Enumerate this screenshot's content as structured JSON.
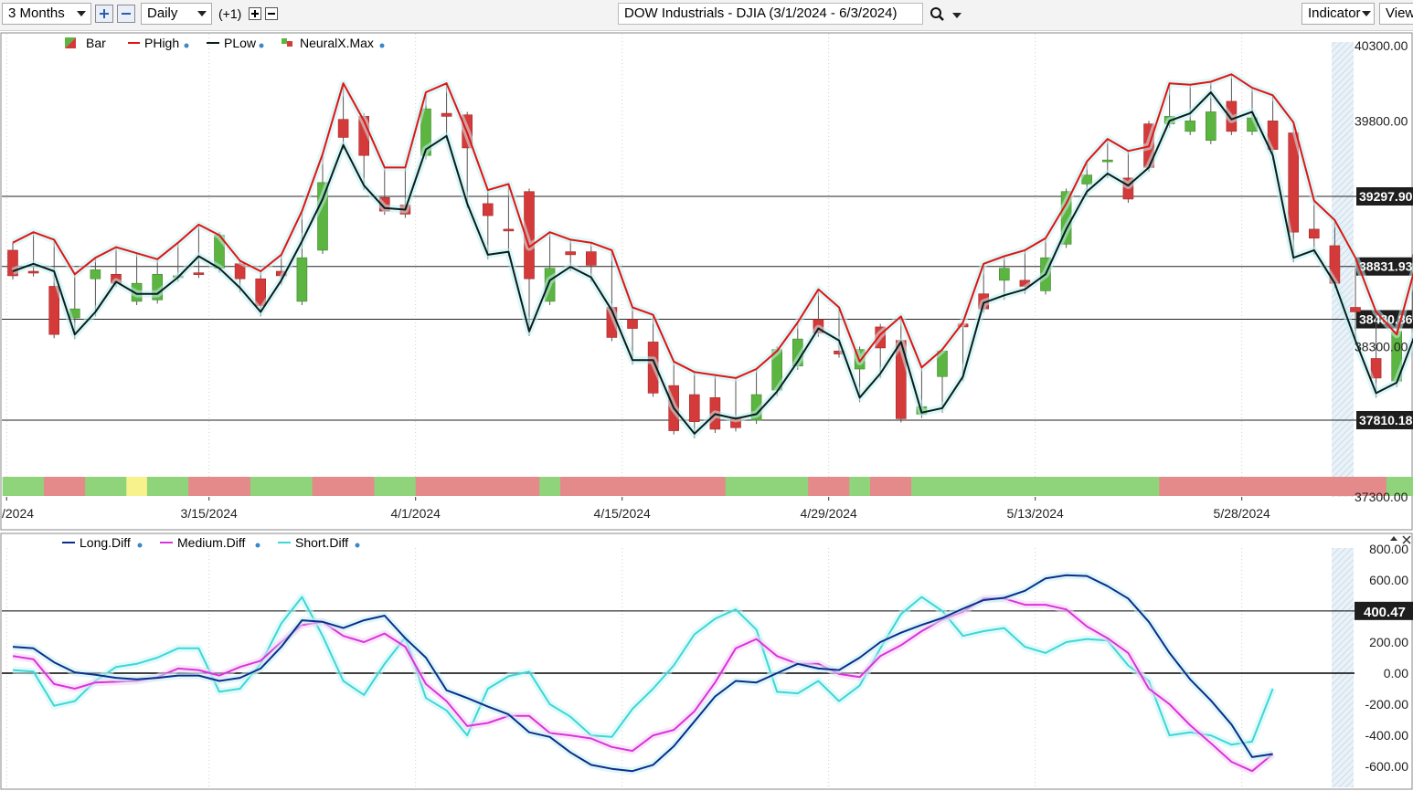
{
  "toolbar": {
    "range": "3 Months",
    "interval": "Daily",
    "offset": "(+1)",
    "chart_title": "DOW Industrials - DJIA (3/1/2024 - 6/3/2024)",
    "indicators": "Indicator",
    "view": "View",
    "search_icon": "magnifier-icon"
  },
  "colors": {
    "up": "#5cb441",
    "down": "#d43a3a",
    "phigh": "#e01414",
    "plow": "#0a1c1c",
    "long": "#0c2d8c",
    "medium": "#d934d9",
    "short": "#3fd6d6",
    "band_green": "#8fd47a",
    "band_red": "#e58a8a",
    "band_yellow": "#f8f28c"
  },
  "price_legend": [
    {
      "label": "Bar",
      "icon": "bar-icon"
    },
    {
      "label": "PHigh",
      "icon": "line-icon"
    },
    {
      "label": "PLow",
      "icon": "line-icon"
    },
    {
      "label": "NeuralX.Max",
      "icon": "bar-icon"
    }
  ],
  "osc_legend": [
    {
      "label": "Long.Diff"
    },
    {
      "label": "Medium.Diff"
    },
    {
      "label": "Short.Diff"
    }
  ],
  "chart_data": [
    {
      "type": "candlestick",
      "ylim": [
        37300,
        40400
      ],
      "y_ticks": [
        "40300.00",
        "39800.00",
        "38300.00",
        "37300.00"
      ],
      "x_ticks": [
        "/2024",
        "3/15/2024",
        "4/1/2024",
        "4/15/2024",
        "4/29/2024",
        "5/13/2024",
        "5/28/2024"
      ],
      "x_tick_index": [
        -0.3,
        9.5,
        19.5,
        29.5,
        39.5,
        49.5,
        59.5
      ],
      "levels": [
        {
          "label": "39297.90",
          "value": 39297.9
        },
        {
          "label": "38831.93",
          "value": 38831.93
        },
        {
          "label": "38480.86",
          "value": 38480.86
        },
        {
          "label": "37810.18",
          "value": 37810.18
        }
      ],
      "candles": [
        [
          38940,
          38770
        ],
        [
          38800,
          38790
        ],
        [
          38700,
          38380
        ],
        [
          38490,
          38550
        ],
        [
          38750,
          38810
        ],
        [
          38780,
          38720
        ],
        [
          38600,
          38720
        ],
        [
          38610,
          38780
        ],
        [
          38760,
          38770
        ],
        [
          38790,
          38780
        ],
        [
          38820,
          39040
        ],
        [
          38850,
          38750
        ],
        [
          38750,
          38570
        ],
        [
          38800,
          38770
        ],
        [
          38600,
          38890
        ],
        [
          38940,
          39390
        ],
        [
          39810,
          39690
        ],
        [
          39830,
          39570
        ],
        [
          39290,
          39200
        ],
        [
          39240,
          39180
        ],
        [
          39570,
          39880
        ],
        [
          39850,
          39830
        ],
        [
          39840,
          39620
        ],
        [
          39250,
          39170
        ],
        [
          39080,
          39070
        ],
        [
          39330,
          38750
        ],
        [
          38600,
          38820
        ],
        [
          38930,
          38910
        ],
        [
          38930,
          38840
        ],
        [
          38560,
          38360
        ],
        [
          38480,
          38420
        ],
        [
          38330,
          37990
        ],
        [
          38040,
          37740
        ],
        [
          37980,
          37800
        ],
        [
          37960,
          37750
        ],
        [
          37830,
          37760
        ],
        [
          37810,
          37980
        ],
        [
          38010,
          38280
        ],
        [
          38170,
          38350
        ],
        [
          38480,
          38390
        ],
        [
          38270,
          38250
        ],
        [
          38150,
          38280
        ],
        [
          38430,
          38290
        ],
        [
          38340,
          37820
        ],
        [
          37850,
          37900
        ],
        [
          38100,
          38270
        ],
        [
          38450,
          38430
        ],
        [
          38650,
          38550
        ],
        [
          38740,
          38820
        ],
        [
          38740,
          38700
        ],
        [
          38670,
          38890
        ],
        [
          38980,
          39330
        ],
        [
          39380,
          39440
        ],
        [
          39530,
          39540
        ],
        [
          39420,
          39280
        ],
        [
          39780,
          39490
        ],
        [
          39780,
          39830
        ],
        [
          39730,
          39800
        ],
        [
          39670,
          39860
        ],
        [
          39930,
          39730
        ],
        [
          39730,
          39820
        ],
        [
          39800,
          39610
        ],
        [
          39720,
          39060
        ],
        [
          39080,
          39020
        ],
        [
          38970,
          38720
        ],
        [
          38560,
          38530
        ],
        [
          38220,
          38090
        ],
        [
          38070,
          38400
        ],
        [
          38480,
          38910
        ]
      ],
      "bands": [
        "g",
        "g",
        "r",
        "r",
        "g",
        "g",
        "y",
        "g",
        "g",
        "r",
        "r",
        "r",
        "g",
        "g",
        "g",
        "r",
        "r",
        "r",
        "g",
        "g",
        "r",
        "r",
        "r",
        "r",
        "r",
        "r",
        "g",
        "r",
        "r",
        "r",
        "r",
        "r",
        "r",
        "r",
        "r",
        "g",
        "g",
        "g",
        "g",
        "r",
        "r",
        "g",
        "r",
        "r",
        "g",
        "g",
        "g",
        "g",
        "g",
        "g",
        "g",
        "g",
        "g",
        "g",
        "g",
        "g",
        "r",
        "r",
        "r",
        "r",
        "r",
        "r",
        "r",
        "r",
        "r",
        "r",
        "r",
        "g",
        "g"
      ],
      "phigh": [
        38990,
        39060,
        39010,
        38780,
        38890,
        38960,
        38920,
        38880,
        38990,
        39110,
        39040,
        38870,
        38800,
        38910,
        39200,
        39580,
        40050,
        39800,
        39490,
        39490,
        39990,
        40050,
        39720,
        39340,
        39380,
        38960,
        39060,
        39010,
        38990,
        38940,
        38560,
        38510,
        38200,
        38130,
        38110,
        38090,
        38150,
        38270,
        38460,
        38680,
        38560,
        38200,
        38380,
        38500,
        38160,
        38280,
        38460,
        38850,
        38900,
        38940,
        39020,
        39250,
        39530,
        39680,
        39600,
        39630,
        40050,
        40040,
        40060,
        40110,
        40020,
        39970,
        39790,
        39270,
        39140,
        38890,
        38530,
        38380,
        38880
      ],
      "plow": [
        38800,
        38850,
        38800,
        38380,
        38530,
        38730,
        38650,
        38650,
        38760,
        38900,
        38820,
        38690,
        38530,
        38740,
        39000,
        39280,
        39640,
        39370,
        39220,
        39210,
        39610,
        39700,
        39250,
        38910,
        38930,
        38400,
        38740,
        38830,
        38760,
        38540,
        38210,
        38210,
        37890,
        37720,
        37850,
        37820,
        37850,
        38000,
        38200,
        38420,
        38340,
        37960,
        38120,
        38330,
        37860,
        37890,
        38100,
        38590,
        38640,
        38680,
        38780,
        39080,
        39330,
        39450,
        39370,
        39490,
        39800,
        39850,
        39990,
        39810,
        39860,
        39570,
        38890,
        38940,
        38720,
        38340,
        37990,
        38060,
        38420
      ]
    },
    {
      "type": "line",
      "ylim": [
        -750,
        800
      ],
      "y_ticks": [
        "800.00",
        "600.00",
        "200.00",
        "0.00",
        "-200.00",
        "-400.00",
        "-600.00"
      ],
      "levels": [
        {
          "label": "400.47",
          "value": 400.47
        },
        {
          "label": "",
          "value": 0
        }
      ],
      "series": [
        {
          "name": "Long.Diff",
          "values": [
            170,
            160,
            70,
            5,
            -10,
            -30,
            -40,
            -30,
            -15,
            -15,
            -50,
            -30,
            30,
            170,
            340,
            330,
            290,
            340,
            370,
            225,
            100,
            -110,
            -160,
            -215,
            -265,
            -380,
            -410,
            -510,
            -590,
            -615,
            -630,
            -590,
            -470,
            -310,
            -150,
            -50,
            -60,
            0,
            60,
            30,
            20,
            100,
            200,
            260,
            310,
            355,
            415,
            470,
            485,
            530,
            610,
            630,
            625,
            560,
            480,
            330,
            130,
            -40,
            -175,
            -330,
            -540,
            -520
          ]
        },
        {
          "name": "Medium.Diff",
          "values": [
            110,
            90,
            -70,
            -100,
            -60,
            -55,
            -50,
            -25,
            30,
            20,
            -15,
            40,
            80,
            200,
            310,
            330,
            240,
            200,
            255,
            170,
            -70,
            -180,
            -340,
            -320,
            -275,
            -275,
            -385,
            -400,
            -420,
            -475,
            -500,
            -400,
            -365,
            -245,
            -60,
            160,
            220,
            110,
            60,
            60,
            -5,
            -25,
            110,
            180,
            270,
            345,
            395,
            480,
            480,
            440,
            440,
            410,
            300,
            225,
            130,
            -100,
            -200,
            -335,
            -450,
            -570,
            -630,
            -520
          ]
        },
        {
          "name": "Short.Diff",
          "values": [
            20,
            10,
            -210,
            -180,
            -50,
            40,
            60,
            100,
            160,
            160,
            -120,
            -100,
            60,
            320,
            490,
            240,
            -50,
            -140,
            60,
            230,
            -160,
            -240,
            -400,
            -100,
            -20,
            10,
            -200,
            -280,
            -400,
            -410,
            -230,
            -100,
            50,
            250,
            350,
            410,
            280,
            -120,
            -130,
            -50,
            -180,
            -80,
            160,
            380,
            490,
            400,
            240,
            270,
            290,
            170,
            130,
            200,
            220,
            210,
            50,
            -50,
            -400,
            -380,
            -400,
            -460,
            -440,
            -100
          ]
        }
      ]
    }
  ]
}
